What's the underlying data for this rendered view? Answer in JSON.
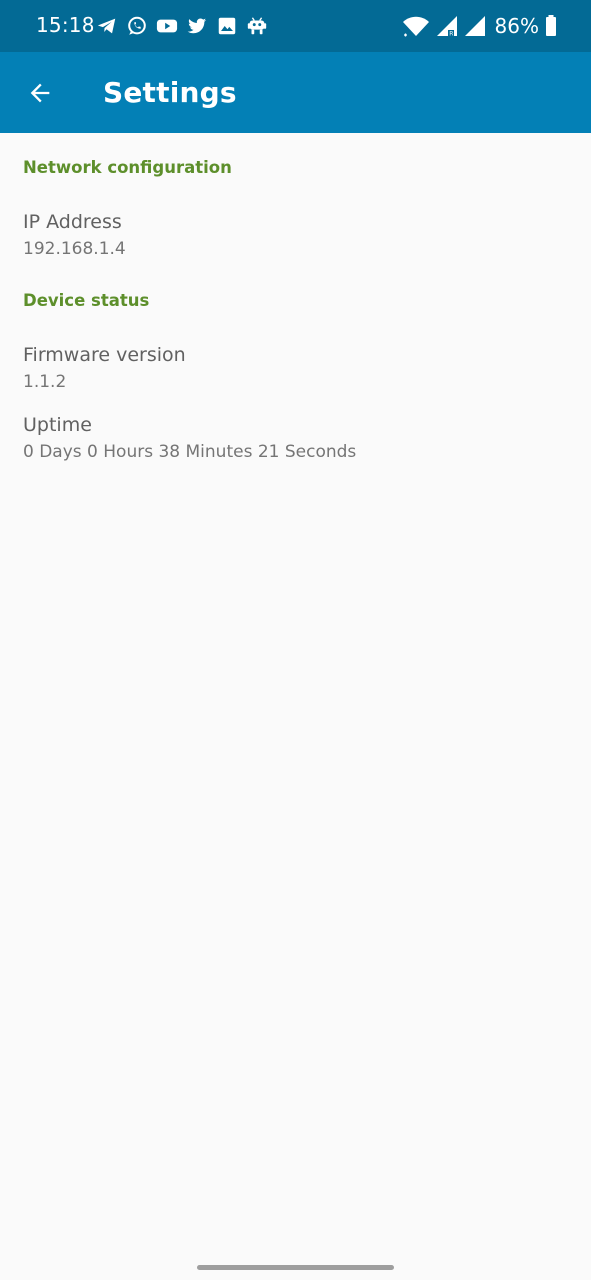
{
  "status_bar": {
    "time": "15:18",
    "notification_icons": [
      "telegram-icon",
      "whatsapp-icon",
      "youtube-icon",
      "twitter-icon",
      "image-icon",
      "android-robot-icon"
    ],
    "system_icons": [
      "wifi-icon",
      "signal-icon",
      "signal-roaming-icon",
      "battery-icon"
    ],
    "battery_percent": "86%"
  },
  "app_bar": {
    "back_icon": "arrow-back-icon",
    "title": "Settings"
  },
  "sections": [
    {
      "title": "Network configuration",
      "items": [
        {
          "title": "IP Address",
          "summary": "192.168.1.4"
        }
      ]
    },
    {
      "title": "Device status",
      "items": [
        {
          "title": "Firmware version",
          "summary": "1.1.2"
        },
        {
          "title": "Uptime",
          "summary": "0 Days 0 Hours 38 Minutes 21 Seconds"
        }
      ]
    }
  ],
  "colors": {
    "status_bar": "#036a95",
    "app_bar": "#0380b6",
    "category_text": "#5d8f2b",
    "background": "#fafafa"
  }
}
